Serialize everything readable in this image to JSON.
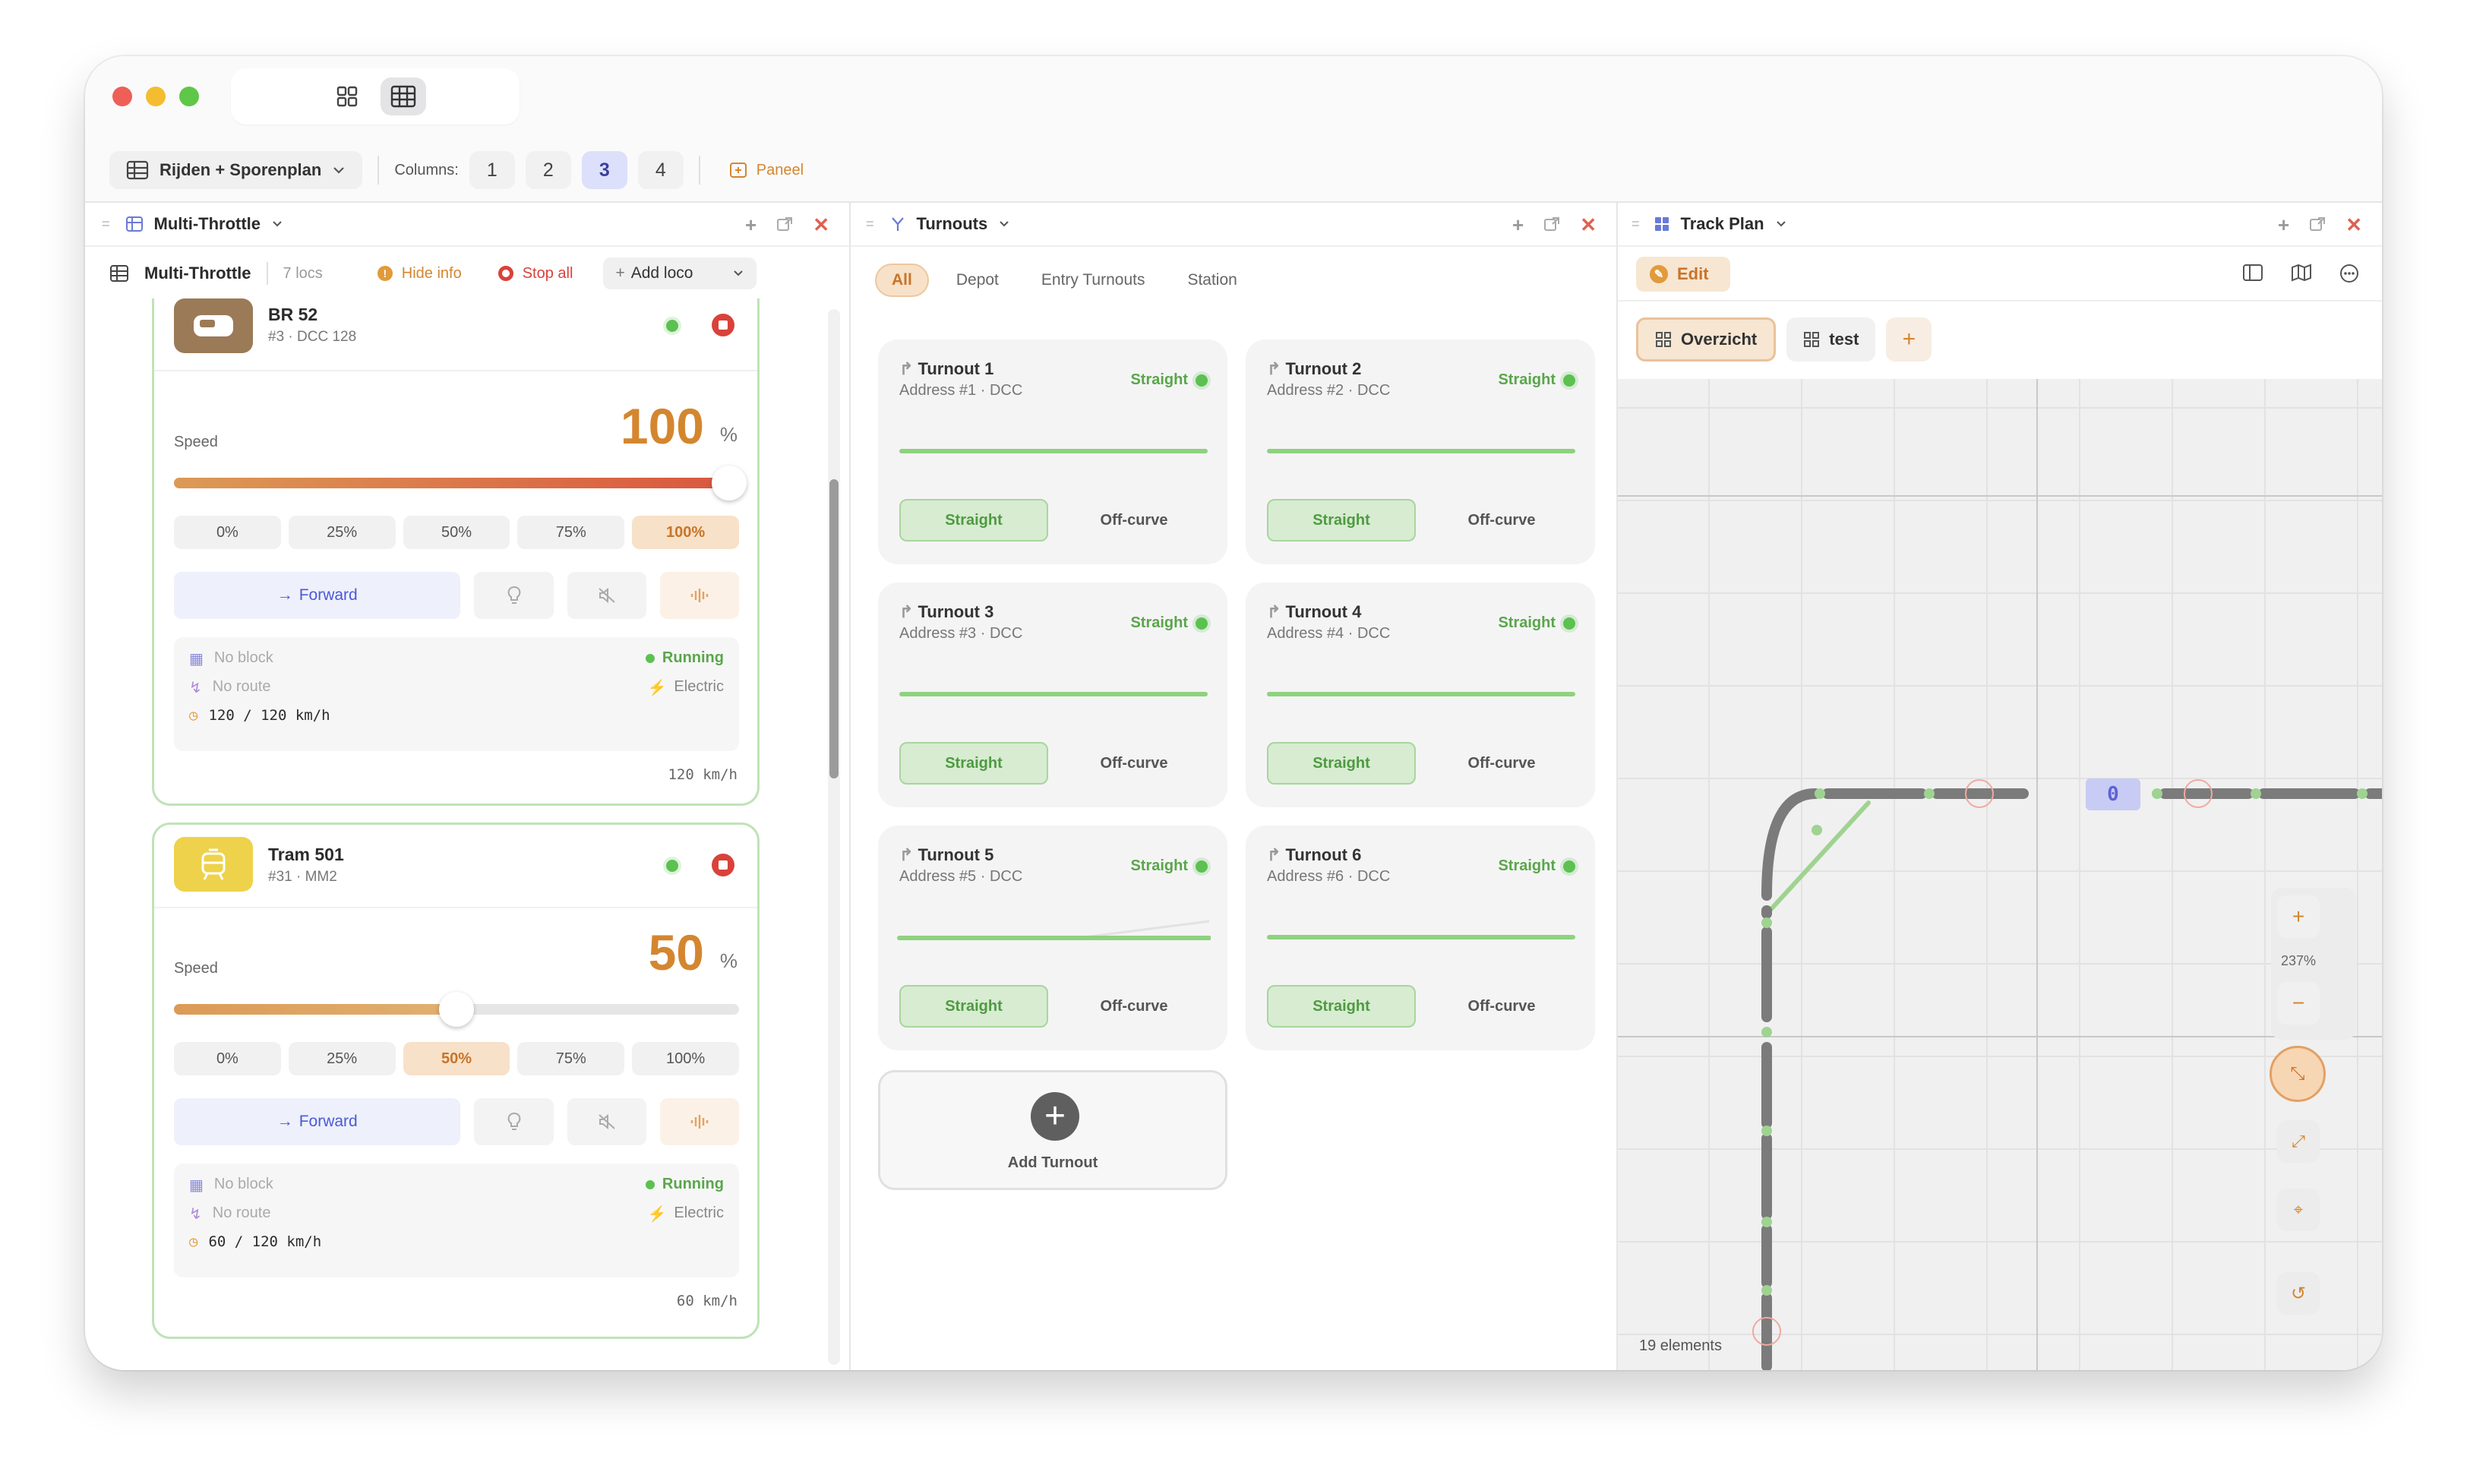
{
  "toolbar": {
    "layout_label": "Rijden + Sporenplan",
    "columns_label": "Columns:",
    "columns": [
      "1",
      "2",
      "3",
      "4"
    ],
    "active_column": "3",
    "panel_label": "Paneel"
  },
  "throttle_panel": {
    "header_title": "Multi-Throttle",
    "sub_title": "Multi-Throttle",
    "loco_count": "7 locs",
    "hide_info": "Hide info",
    "stop_all": "Stop all",
    "add_loco": "Add loco",
    "speed_label": "Speed",
    "presets": [
      "0%",
      "25%",
      "50%",
      "75%",
      "100%"
    ],
    "locos": [
      {
        "name": "BR 52",
        "meta": "#3 · DCC 128",
        "speed": "100",
        "unit": "%",
        "speed_fraction": 1.0,
        "active_preset": "100%",
        "direction": "Forward",
        "block": "No block",
        "route": "No route",
        "status": "Running",
        "traction": "Electric",
        "speed_text": "120 / 120 km/h",
        "footer": "120 km/h"
      },
      {
        "name": "Tram 501",
        "meta": "#31 · MM2",
        "speed": "50",
        "unit": "%",
        "speed_fraction": 0.5,
        "active_preset": "50%",
        "direction": "Forward",
        "block": "No block",
        "route": "No route",
        "status": "Running",
        "traction": "Electric",
        "speed_text": "60 / 120 km/h",
        "footer": "60 km/h"
      }
    ]
  },
  "turnouts_panel": {
    "header_title": "Turnouts",
    "filters": [
      "All",
      "Depot",
      "Entry Turnouts",
      "Station"
    ],
    "active_filter": "All",
    "straight_label": "Straight",
    "offcurve_label": "Off-curve",
    "turnouts": [
      {
        "name": "Turnout 1",
        "address": "Address #1 · DCC",
        "state": "Straight"
      },
      {
        "name": "Turnout 2",
        "address": "Address #2 · DCC",
        "state": "Straight"
      },
      {
        "name": "Turnout 3",
        "address": "Address #3 · DCC",
        "state": "Straight"
      },
      {
        "name": "Turnout 4",
        "address": "Address #4 · DCC",
        "state": "Straight"
      },
      {
        "name": "Turnout 5",
        "address": "Address #5 · DCC",
        "state": "Straight"
      },
      {
        "name": "Turnout 6",
        "address": "Address #6 · DCC",
        "state": "Straight"
      }
    ],
    "add_label": "Add Turnout"
  },
  "trackplan_panel": {
    "header_title": "Track Plan",
    "edit_label": "Edit",
    "tabs": [
      "Overzicht",
      "test"
    ],
    "active_tab": "Overzicht",
    "block_label": "0",
    "zoom": "237%",
    "element_count": "19 elements"
  },
  "colors": {
    "accent": "#d4862f",
    "green": "#5cc150",
    "stop": "#d9423a",
    "blue": "#4a5ad6"
  }
}
